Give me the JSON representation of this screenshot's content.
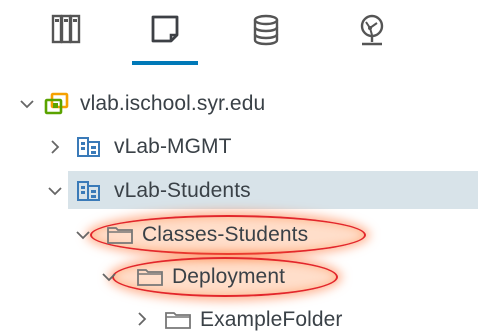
{
  "tabs": [
    {
      "name": "hosts-and-clusters",
      "icon": "hosts-clusters-icon"
    },
    {
      "name": "vms-and-templates",
      "icon": "vms-templates-icon",
      "active": true
    },
    {
      "name": "storage",
      "icon": "storage-icon"
    },
    {
      "name": "networking",
      "icon": "networking-icon"
    }
  ],
  "colors": {
    "accent": "#0079b8",
    "selected_row": "#d8e3e9",
    "highlight": "#e3262a",
    "vcenter_green": "#5aa300",
    "vcenter_orange": "#f5a100",
    "datacenter_blue": "#3a7ab8"
  },
  "tree": {
    "vcenter": {
      "label": "vlab.ischool.syr.edu",
      "expanded": true
    },
    "datacenter_mgmt": {
      "label": "vLab-MGMT",
      "expanded": false
    },
    "datacenter_students": {
      "label": "vLab-Students",
      "expanded": true,
      "selected": true
    },
    "folder_classes": {
      "label": "Classes-Students",
      "expanded": true,
      "highlighted": true
    },
    "folder_deployment": {
      "label": "Deployment",
      "expanded": true,
      "highlighted": true
    },
    "folder_example": {
      "label": "ExampleFolder",
      "expanded": false
    }
  }
}
